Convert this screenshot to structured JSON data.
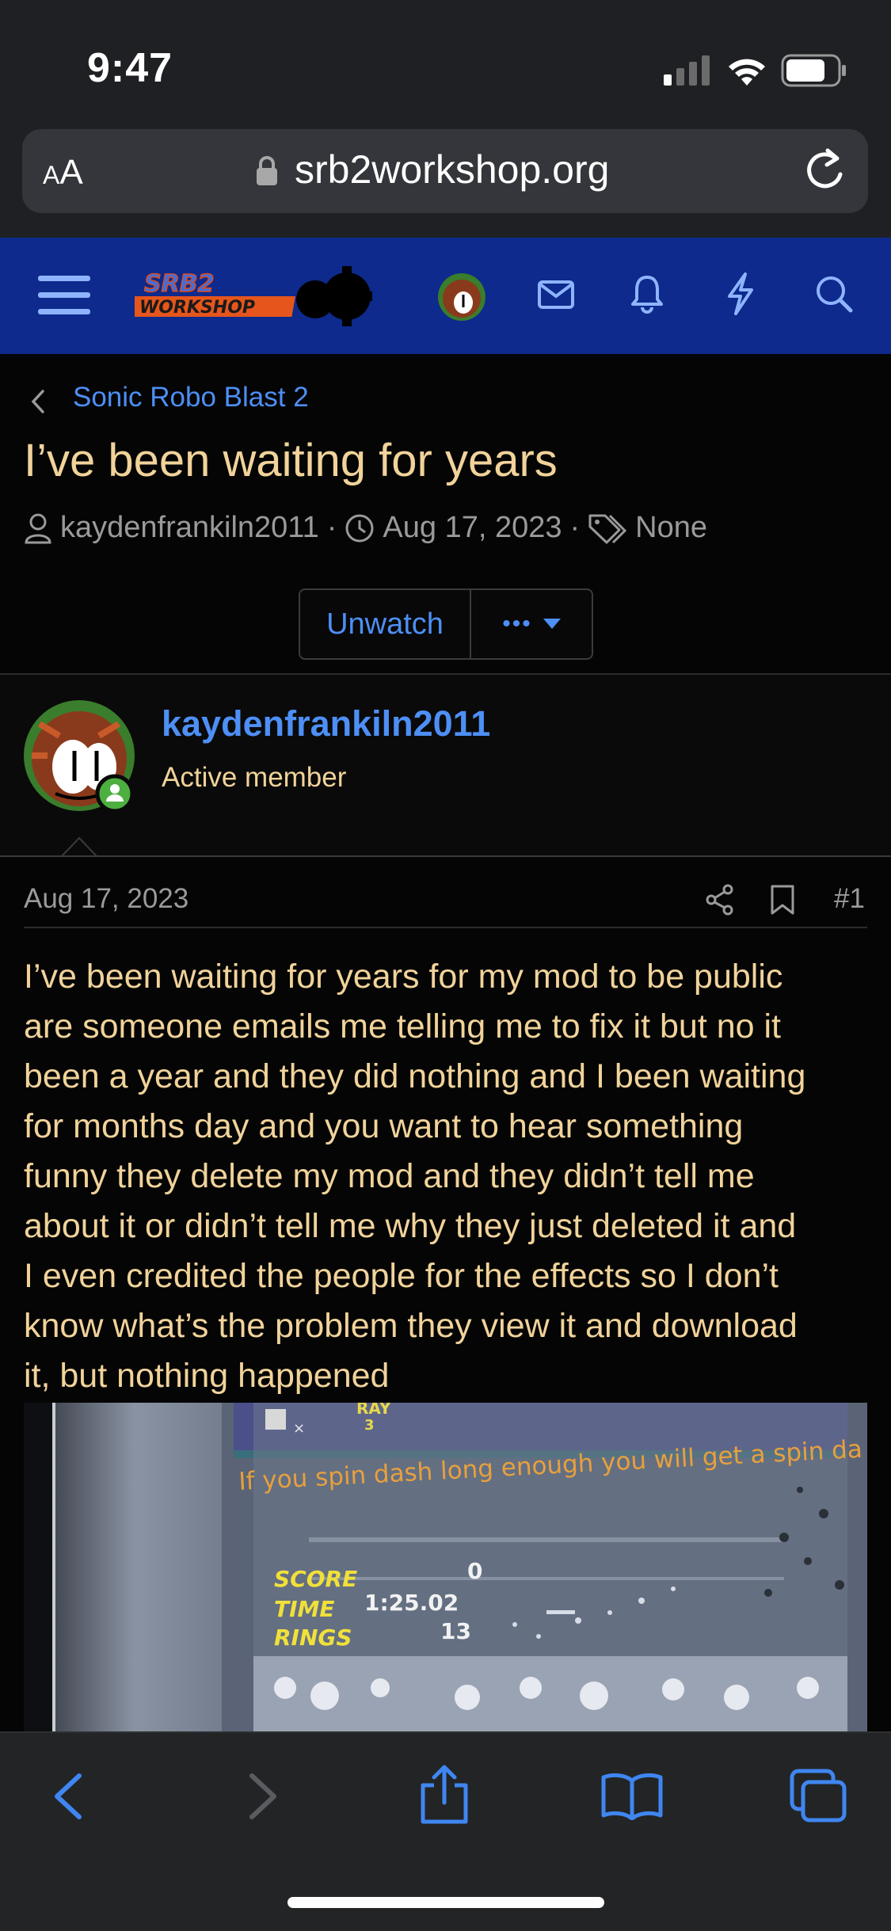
{
  "status_bar": {
    "time": "9:47"
  },
  "browser": {
    "text_size_label_small": "A",
    "text_size_label_large": "A",
    "url": "srb2workshop.org"
  },
  "site_header": {
    "logo_text_top": "SRB2",
    "logo_text_bottom": "WORKSHOP"
  },
  "thread": {
    "breadcrumb": "Sonic Robo Blast 2",
    "title": "I’ve been waiting for years",
    "author": "kaydenfrankiln2011",
    "separator": "·",
    "date": "Aug 17, 2023",
    "tags": "None",
    "unwatch_label": "Unwatch",
    "more_label": "•••"
  },
  "post": {
    "username": "kaydenfrankiln2011",
    "user_title": "Active member",
    "date": "Aug 17, 2023",
    "number": "#1",
    "body_lines": [
      "I’ve been waiting for years for my mod to be public",
      "are someone emails me telling me to fix it but no it",
      "been a year and they did nothing and I been waiting",
      "for months day and you want to hear something",
      "funny they delete my mod and they didn’t tell me",
      "about it or didn’t tell me why they just deleted it and",
      "I even credited the people for the effects so I don’t",
      "know what’s the problem they view it and download",
      "it, but nothing happened"
    ],
    "image": {
      "lives_name": "RAY",
      "lives_x": "×",
      "lives_count": "3",
      "tip": "If you spin dash long enough you will get a spin da",
      "score_label": "SCORE",
      "score_value": "0",
      "time_label": "TIME",
      "time_value": "1:25.02",
      "rings_label": "RINGS",
      "rings_value": "13"
    }
  },
  "colors": {
    "header_blue": "#0d2a8c",
    "link_blue": "#4d8ff5",
    "title_gold": "#f1d39a",
    "online_green": "#4caf3f"
  },
  "icons": {
    "status": [
      "signal-icon",
      "wifi-icon",
      "battery-icon"
    ],
    "header": [
      "menu-icon",
      "avatar-icon",
      "mail-icon",
      "bell-icon",
      "bolt-icon",
      "search-icon"
    ],
    "toolbar": [
      "back-icon",
      "forward-icon",
      "share-icon",
      "bookmarks-icon",
      "tabs-icon"
    ]
  }
}
